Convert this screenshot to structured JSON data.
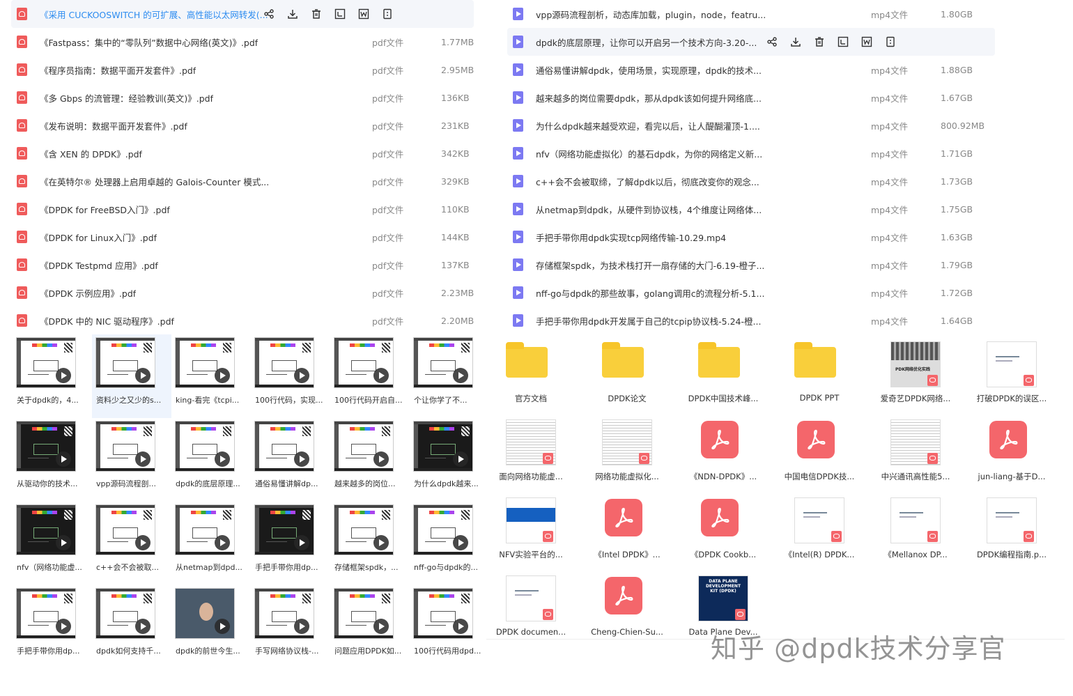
{
  "left_list": {
    "rows": [
      {
        "name": "《采用 CUCKOOSWITCH 的可扩展、高性能以太网转发(...",
        "type": "",
        "size": "",
        "selected": true
      },
      {
        "name": "《Fastpass：集中的“零队列”数据中心网络(英文)》.pdf",
        "type": "pdf文件",
        "size": "1.77MB"
      },
      {
        "name": "《程序员指南：数据平面开发套件》.pdf",
        "type": "pdf文件",
        "size": "2.95MB"
      },
      {
        "name": "《多 Gbps 的流管理：经验教训(英文)》.pdf",
        "type": "pdf文件",
        "size": "136KB"
      },
      {
        "name": "《发布说明：数据平面开发套件》.pdf",
        "type": "pdf文件",
        "size": "231KB"
      },
      {
        "name": "《含 XEN 的 DPDK》.pdf",
        "type": "pdf文件",
        "size": "342KB"
      },
      {
        "name": "《在英特尔® 处理器上启用卓越的 Galois-Counter 模式...",
        "type": "pdf文件",
        "size": "329KB"
      },
      {
        "name": "《DPDK for FreeBSD入门》.pdf",
        "type": "pdf文件",
        "size": "110KB"
      },
      {
        "name": "《DPDK for Linux入门》.pdf",
        "type": "pdf文件",
        "size": "144KB"
      },
      {
        "name": "《DPDK Testpmd 应用》.pdf",
        "type": "pdf文件",
        "size": "137KB"
      },
      {
        "name": "《DPDK 示例应用》.pdf",
        "type": "pdf文件",
        "size": "2.23MB"
      },
      {
        "name": "《DPDK 中的 NIC 驱动程序》.pdf",
        "type": "pdf文件",
        "size": "2.20MB"
      }
    ]
  },
  "right_list": {
    "rows": [
      {
        "name": "vpp源码流程剖析，动态库加载，plugin，node，featru...",
        "type": "mp4文件",
        "size": "1.80GB"
      },
      {
        "name": "dpdk的底层原理，让你可以开启另一个技术方向-3.20-...",
        "type": "",
        "size": "",
        "selected": true
      },
      {
        "name": "通俗易懂讲解dpdk，使用场景，实现原理，dpdk的技术...",
        "type": "mp4文件",
        "size": "1.88GB"
      },
      {
        "name": "越来越多的岗位需要dpdk，那从dpdk该如何提升网络底...",
        "type": "mp4文件",
        "size": "1.67GB"
      },
      {
        "name": "为什么dpdk越来越受欢迎，看完以后，让人醍醐灌顶-1....",
        "type": "mp4文件",
        "size": "800.92MB"
      },
      {
        "name": "nfv（网络功能虚拟化）的基石dpdk，为你的网络定义新...",
        "type": "mp4文件",
        "size": "1.71GB"
      },
      {
        "name": "c++会不会被取缔，了解dpdk以后，彻底改变你的观念...",
        "type": "mp4文件",
        "size": "1.73GB"
      },
      {
        "name": "从netmap到dpdk，从硬件到协议栈，4个维度让网络体...",
        "type": "mp4文件",
        "size": "1.75GB"
      },
      {
        "name": "手把手带你用dpdk实现tcp网络传输-10.29.mp4",
        "type": "mp4文件",
        "size": "1.63GB"
      },
      {
        "name": "存储框架spdk，为技术栈打开一扇存储的大门-6.19-橙子...",
        "type": "mp4文件",
        "size": "1.79GB"
      },
      {
        "name": "nff-go与dpdk的那些故事，golang调用c的流程分析-5.1...",
        "type": "mp4文件",
        "size": "1.72GB"
      },
      {
        "name": "手把手带你用dpdk开发属于自己的tcpip协议栈-5.24-橙...",
        "type": "mp4文件",
        "size": "1.64GB"
      }
    ]
  },
  "row_actions": [
    "share-icon",
    "download-icon",
    "delete-icon",
    "rename-icon",
    "word-icon",
    "more-icon"
  ],
  "thumbnails": [
    {
      "label": "关于dpdk的，4...",
      "style": "light"
    },
    {
      "label": "资料少之又少的s...",
      "style": "light",
      "selected": true
    },
    {
      "label": "king-看完《tcpi...",
      "style": "light"
    },
    {
      "label": "100行代码，实现...",
      "style": "light"
    },
    {
      "label": "100行代码开启自...",
      "style": "light"
    },
    {
      "label": "个让你学了不...",
      "style": "light"
    },
    {
      "label": "从驱动你的技术...",
      "style": "dark"
    },
    {
      "label": "vpp源码流程剖...",
      "style": "light"
    },
    {
      "label": "dpdk的底层原理...",
      "style": "light"
    },
    {
      "label": "通俗易懂讲解dp...",
      "style": "light"
    },
    {
      "label": "越来越多的岗位...",
      "style": "light"
    },
    {
      "label": "为什么dpdk越来...",
      "style": "dark"
    },
    {
      "label": "nfv（网络功能虚...",
      "style": "dark"
    },
    {
      "label": "c++会不会被取...",
      "style": "light"
    },
    {
      "label": "从netmap到dpd...",
      "style": "light"
    },
    {
      "label": "手把手带你用dp...",
      "style": "dark"
    },
    {
      "label": "存储框架spdk，...",
      "style": "light"
    },
    {
      "label": "nff-go与dpdk的...",
      "style": "light"
    },
    {
      "label": "手把手带你用dp...",
      "style": "light"
    },
    {
      "label": "dpdk如何支持千...",
      "style": "light"
    },
    {
      "label": "dpdk的前世今生...",
      "style": "photo"
    },
    {
      "label": "手写网络协议栈-...",
      "style": "light"
    },
    {
      "label": "问题应用DPDK如...",
      "style": "light"
    },
    {
      "label": "100行代码用dpd...",
      "style": "light"
    }
  ],
  "grid_items": [
    {
      "label": "官方文档",
      "kind": "folder"
    },
    {
      "label": "DPDK论文",
      "kind": "folder"
    },
    {
      "label": "DPDK中国技术峰...",
      "kind": "folder"
    },
    {
      "label": "DPDK  PPT",
      "kind": "folder"
    },
    {
      "label": "爱奇艺DPDK网络...",
      "kind": "photo",
      "caption": "PDK网络优化实践"
    },
    {
      "label": "打破DPDK的误区...",
      "kind": "light"
    },
    {
      "label": "面向网络功能虚...",
      "kind": "doc"
    },
    {
      "label": "网络功能虚拟化...",
      "kind": "doc"
    },
    {
      "label": "《NDN-DPDK》...",
      "kind": "pdf"
    },
    {
      "label": "中国电信DPDK技...",
      "kind": "pdf"
    },
    {
      "label": "中兴通讯高性能5...",
      "kind": "doc"
    },
    {
      "label": "jun-liang-基于D...",
      "kind": "pdf"
    },
    {
      "label": "NFV实验平台的...",
      "kind": "blue"
    },
    {
      "label": "《Intel DPDK》...",
      "kind": "pdf"
    },
    {
      "label": "《DPDK Cookb...",
      "kind": "pdf"
    },
    {
      "label": "《Intel(R) DPDK...",
      "kind": "light"
    },
    {
      "label": "《Mellanox DP...",
      "kind": "light"
    },
    {
      "label": "DPDK编程指南.p...",
      "kind": "light"
    },
    {
      "label": "DPDK documen...",
      "kind": "light"
    },
    {
      "label": "Cheng-Chien-Su...",
      "kind": "pdf"
    },
    {
      "label": "Data Plane Dev...",
      "kind": "cover",
      "caption": "DATA PLANE DEVELOPMENT KIT (DPDK)"
    }
  ],
  "watermark": "知乎 @dpdk技术分享官"
}
